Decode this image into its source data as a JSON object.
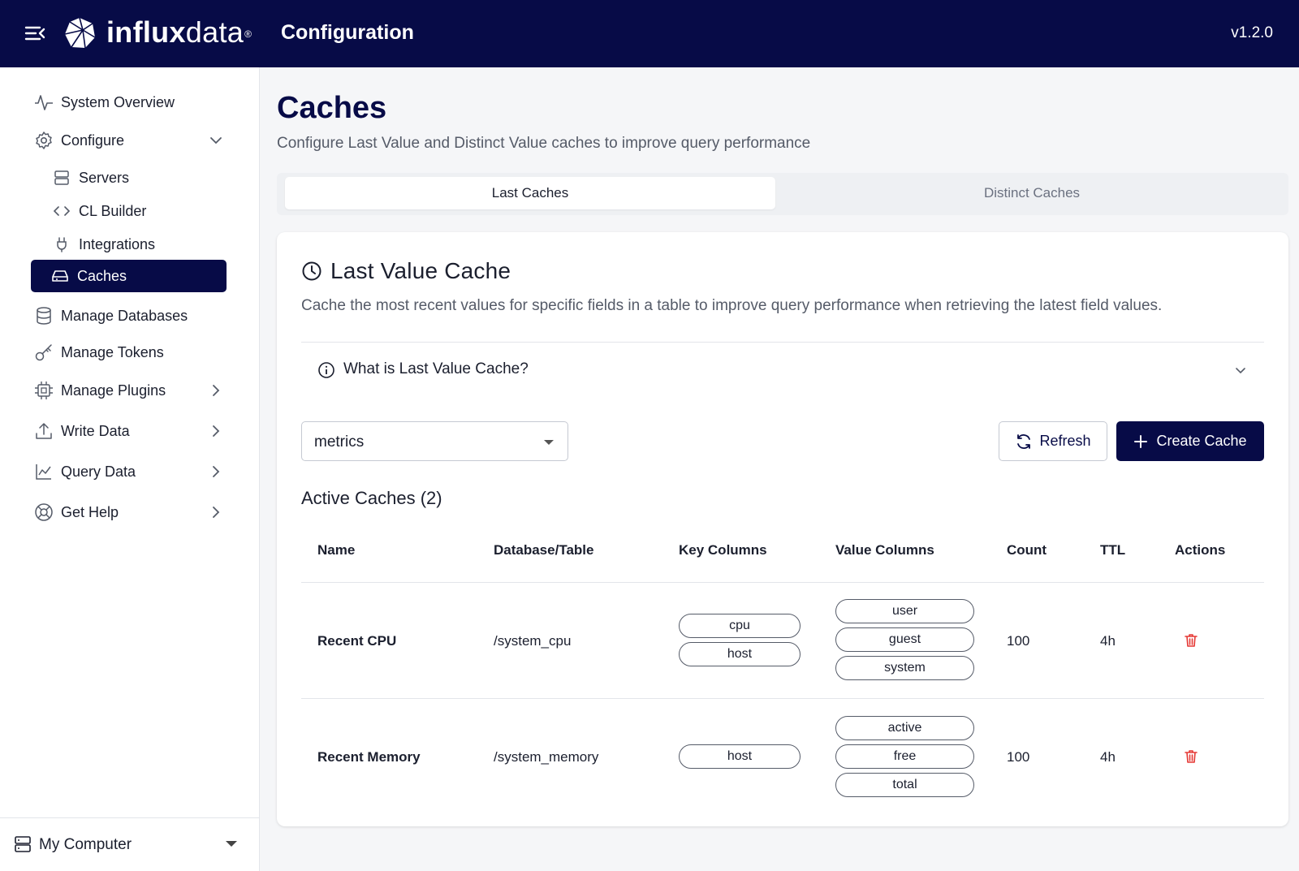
{
  "header": {
    "brand_bold": "influx",
    "brand_light": "data",
    "brand_reg": "®",
    "title": "Configuration",
    "version": "v1.2.0"
  },
  "sidebar": {
    "items": [
      {
        "label": "System Overview",
        "icon": "activity-icon"
      },
      {
        "label": "Configure",
        "icon": "gear-icon",
        "expanded": true
      },
      {
        "label": "Servers",
        "icon": "server-icon"
      },
      {
        "label": "CL Builder",
        "icon": "code-icon"
      },
      {
        "label": "Integrations",
        "icon": "plug-icon"
      },
      {
        "label": "Caches",
        "icon": "drive-icon",
        "active": true
      },
      {
        "label": "Manage Databases",
        "icon": "database-icon"
      },
      {
        "label": "Manage Tokens",
        "icon": "key-icon"
      },
      {
        "label": "Manage Plugins",
        "icon": "chip-icon"
      },
      {
        "label": "Write Data",
        "icon": "upload-icon"
      },
      {
        "label": "Query Data",
        "icon": "chart-line-icon"
      },
      {
        "label": "Get Help",
        "icon": "lifebuoy-icon"
      }
    ],
    "footer": {
      "label": "My Computer",
      "icon": "server-icon"
    }
  },
  "page": {
    "title": "Caches",
    "subtitle": "Configure Last Value and Distinct Value caches to improve query performance",
    "tabs": [
      {
        "label": "Last Caches",
        "active": true
      },
      {
        "label": "Distinct Caches",
        "active": false
      }
    ]
  },
  "card": {
    "title": "Last Value Cache",
    "description": "Cache the most recent values for specific fields in a table to improve query performance when retrieving the latest field values.",
    "accordion_label": "What is Last Value Cache?",
    "database_select": "metrics",
    "refresh_label": "Refresh",
    "create_label": "Create Cache",
    "section_title": "Active Caches (2)",
    "columns": [
      "Name",
      "Database/Table",
      "Key Columns",
      "Value Columns",
      "Count",
      "TTL",
      "Actions"
    ],
    "rows": [
      {
        "name": "Recent CPU",
        "table": "/system_cpu",
        "keys": [
          "cpu",
          "host"
        ],
        "values": [
          "user",
          "guest",
          "system"
        ],
        "count": "100",
        "ttl": "4h"
      },
      {
        "name": "Recent Memory",
        "table": "/system_memory",
        "keys": [
          "host"
        ],
        "values": [
          "active",
          "free",
          "total"
        ],
        "count": "100",
        "ttl": "4h"
      }
    ]
  },
  "colors": {
    "navy": "#070b47",
    "danger": "#e53935"
  }
}
